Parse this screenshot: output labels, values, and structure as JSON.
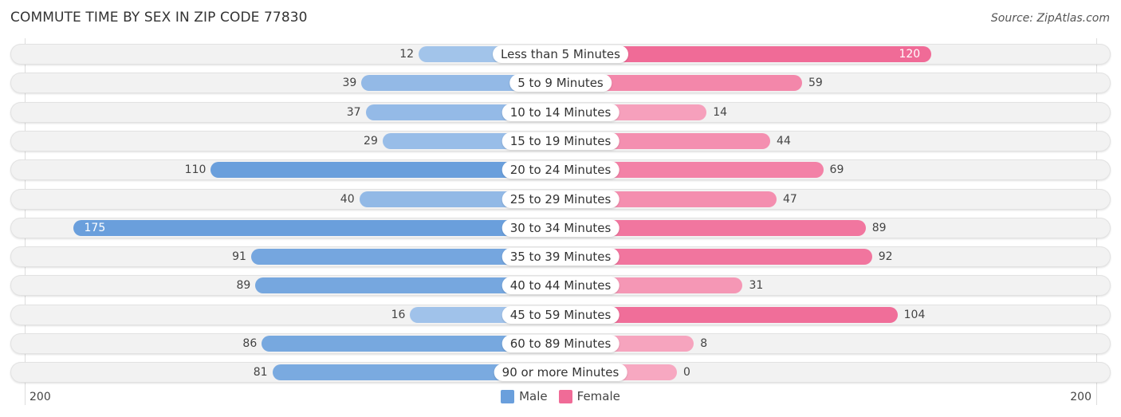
{
  "title": "COMMUTE TIME BY SEX IN ZIP CODE 77830",
  "source": "Source: ZipAtlas.com",
  "colors": {
    "male": "#6a9fdc",
    "male_light": "#a9c8ec",
    "female": "#f06b97",
    "female_light": "#f7a8c1"
  },
  "chart_data": {
    "type": "bar",
    "orientation": "horizontal-diverging",
    "title": "COMMUTE TIME BY SEX IN ZIP CODE 77830",
    "categories": [
      "Less than 5 Minutes",
      "5 to 9 Minutes",
      "10 to 14 Minutes",
      "15 to 19 Minutes",
      "20 to 24 Minutes",
      "25 to 29 Minutes",
      "30 to 34 Minutes",
      "35 to 39 Minutes",
      "40 to 44 Minutes",
      "45 to 59 Minutes",
      "60 to 89 Minutes",
      "90 or more Minutes"
    ],
    "series": [
      {
        "name": "Male",
        "values": [
          12,
          39,
          37,
          29,
          110,
          40,
          175,
          91,
          89,
          16,
          86,
          81
        ]
      },
      {
        "name": "Female",
        "values": [
          120,
          59,
          14,
          44,
          69,
          47,
          89,
          92,
          31,
          104,
          8,
          0
        ]
      }
    ],
    "xlim": [
      -200,
      200
    ],
    "axis_labels": {
      "left": "200",
      "right": "200"
    },
    "legend": {
      "position": "bottom-center",
      "entries": [
        "Male",
        "Female"
      ]
    }
  }
}
